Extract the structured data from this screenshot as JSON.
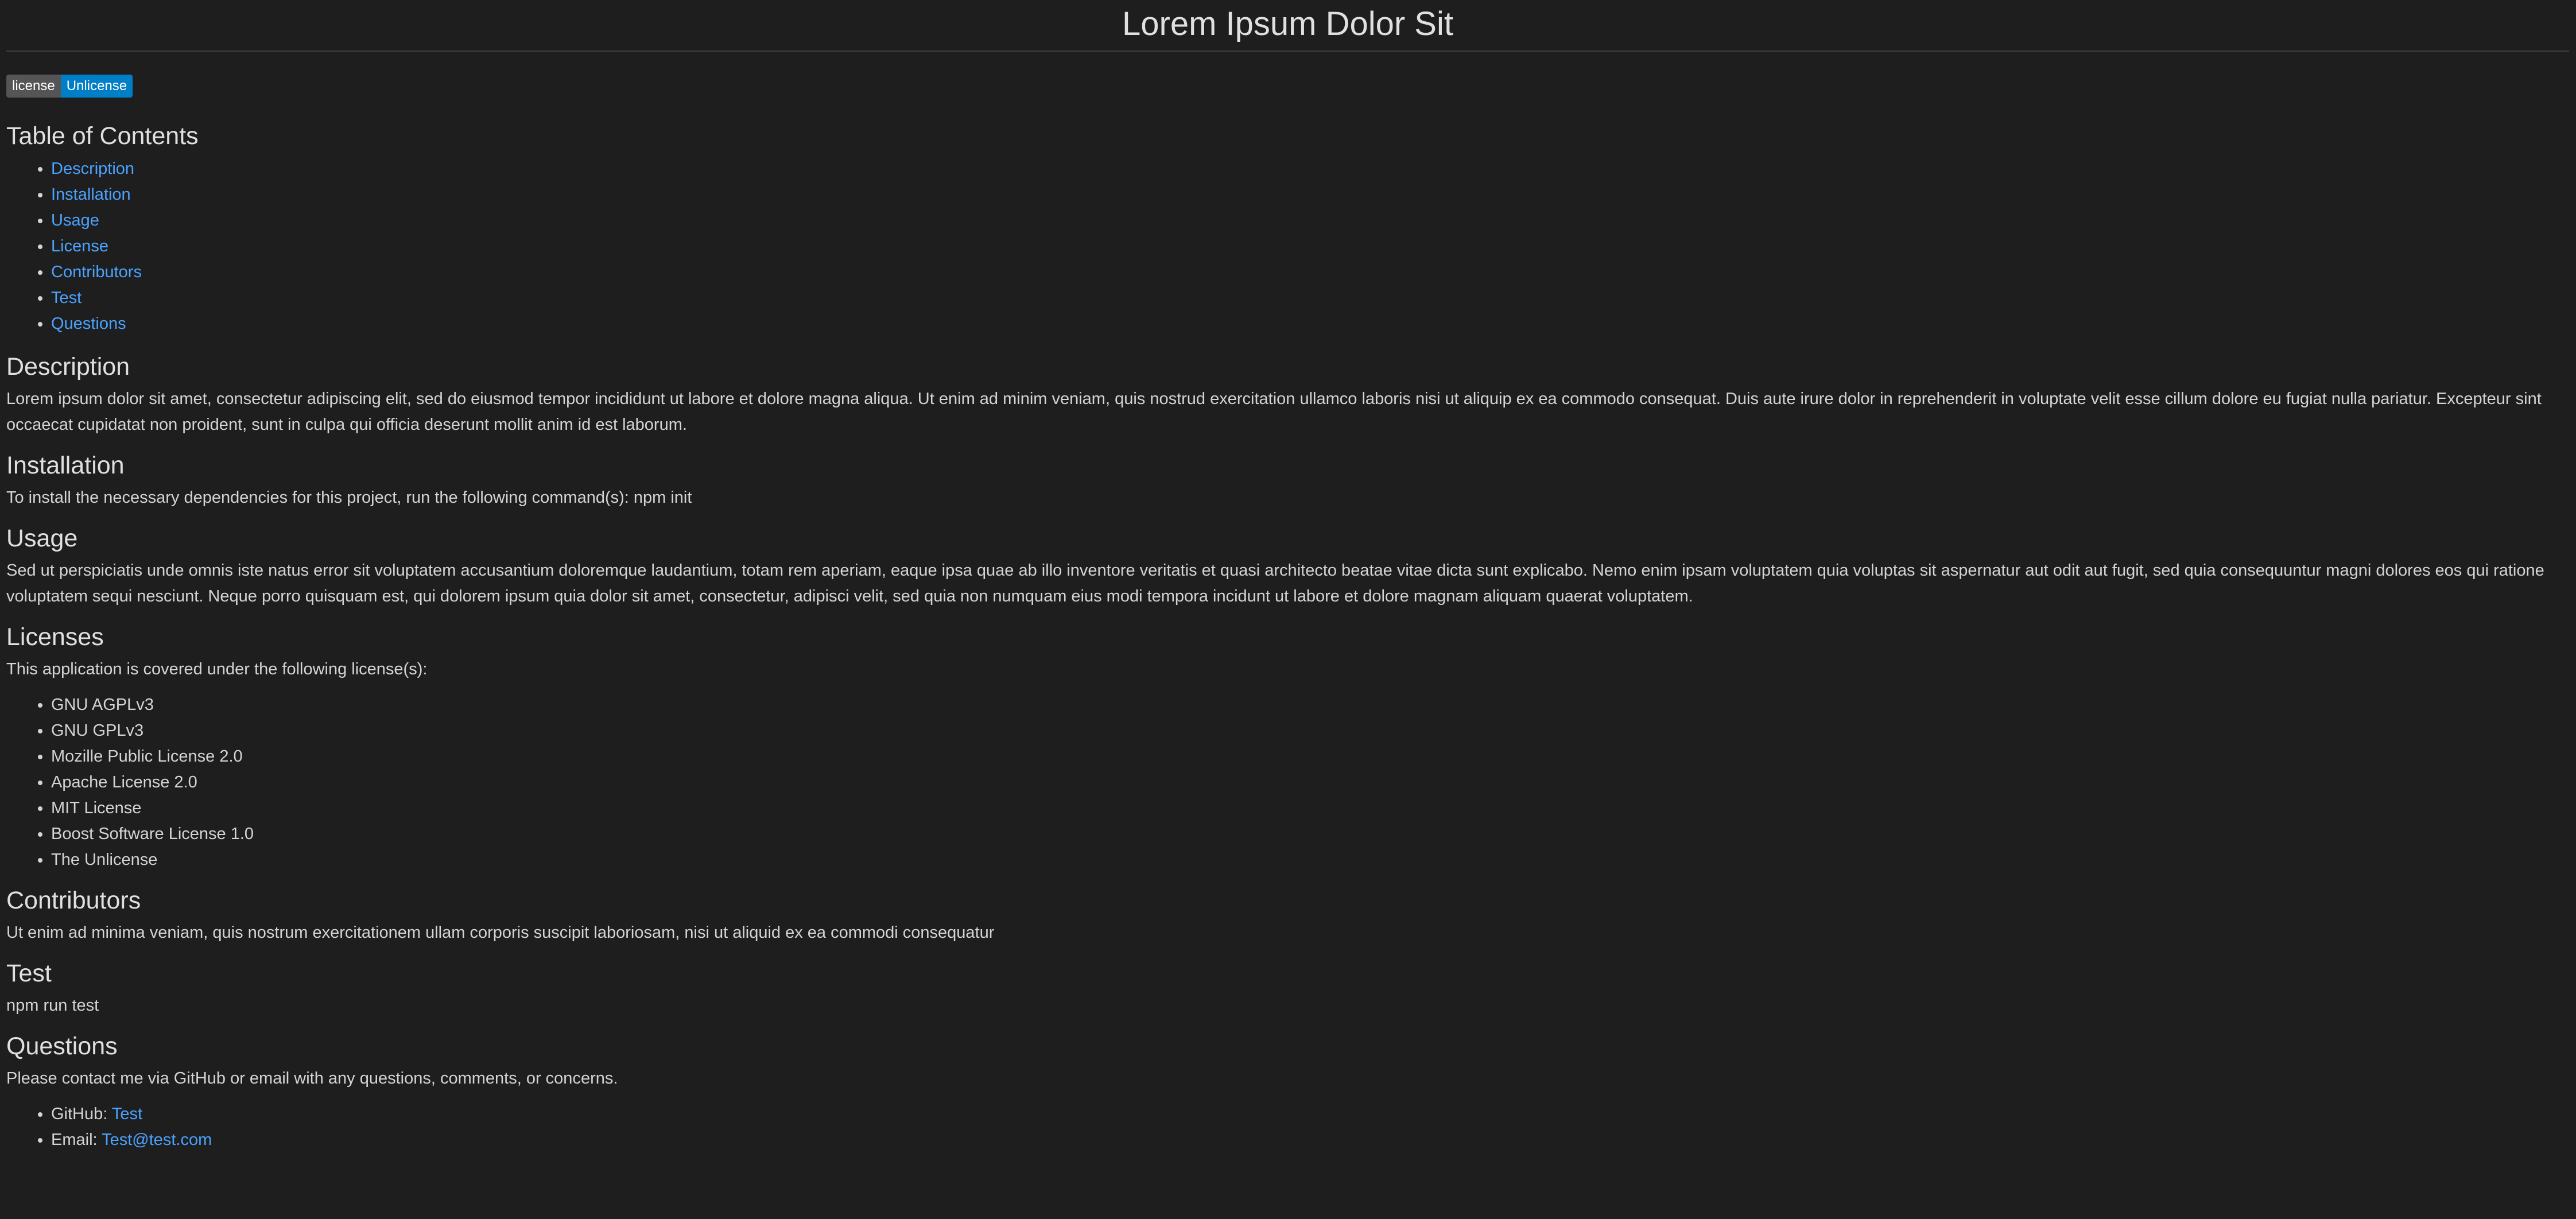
{
  "title": "Lorem Ipsum Dolor Sit",
  "badge": {
    "left": "license",
    "right": "Unlicense",
    "left_color": "#555555",
    "right_color": "#007ec6"
  },
  "toc": {
    "heading": "Table of Contents",
    "items": [
      "Description",
      "Installation",
      "Usage",
      "License",
      "Contributors",
      "Test",
      "Questions"
    ]
  },
  "description": {
    "heading": "Description",
    "text": "Lorem ipsum dolor sit amet, consectetur adipiscing elit, sed do eiusmod tempor incididunt ut labore et dolore magna aliqua. Ut enim ad minim veniam, quis nostrud exercitation ullamco laboris nisi ut aliquip ex ea commodo consequat. Duis aute irure dolor in reprehenderit in voluptate velit esse cillum dolore eu fugiat nulla pariatur. Excepteur sint occaecat cupidatat non proident, sunt in culpa qui officia deserunt mollit anim id est laborum."
  },
  "installation": {
    "heading": "Installation",
    "text": "To install the necessary dependencies for this project, run the following command(s): npm init"
  },
  "usage": {
    "heading": "Usage",
    "text": "Sed ut perspiciatis unde omnis iste natus error sit voluptatem accusantium doloremque laudantium, totam rem aperiam, eaque ipsa quae ab illo inventore veritatis et quasi architecto beatae vitae dicta sunt explicabo. Nemo enim ipsam voluptatem quia voluptas sit aspernatur aut odit aut fugit, sed quia consequuntur magni dolores eos qui ratione voluptatem sequi nesciunt. Neque porro quisquam est, qui dolorem ipsum quia dolor sit amet, consectetur, adipisci velit, sed quia non numquam eius modi tempora incidunt ut labore et dolore magnam aliquam quaerat voluptatem."
  },
  "licenses": {
    "heading": "Licenses",
    "intro": "This application is covered under the following license(s):",
    "items": [
      "GNU AGPLv3",
      "GNU GPLv3",
      "Mozille Public License 2.0",
      "Apache License 2.0",
      "MIT License",
      "Boost Software License 1.0",
      "The Unlicense"
    ]
  },
  "contributors": {
    "heading": "Contributors",
    "text": "Ut enim ad minima veniam, quis nostrum exercitationem ullam corporis suscipit laboriosam, nisi ut aliquid ex ea commodi consequatur"
  },
  "test": {
    "heading": "Test",
    "text": "npm run test"
  },
  "questions": {
    "heading": "Questions",
    "intro": "Please contact me via GitHub or email with any questions, comments, or concerns.",
    "github_label": "GitHub: ",
    "github_link": "Test",
    "email_label": "Email: ",
    "email_link": "Test@test.com"
  },
  "colors": {
    "background": "#1e1e1e",
    "text": "#d4d4d4",
    "link": "#4aa3ff"
  }
}
